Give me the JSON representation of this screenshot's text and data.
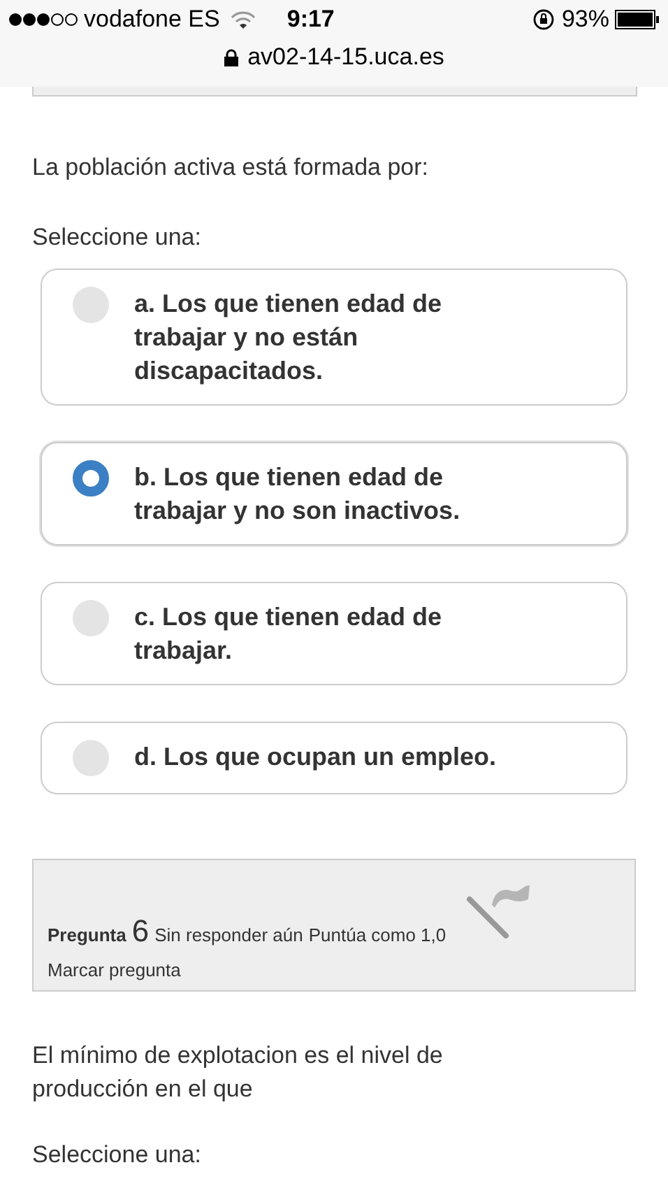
{
  "status_bar": {
    "carrier": "vodafone ES",
    "time": "9:17",
    "battery": "93%"
  },
  "address_bar": {
    "url": "av02-14-15.uca.es"
  },
  "question_5": {
    "text": "La población activa está formada por:",
    "prompt": "Seleccione una:",
    "options": [
      {
        "label": "a. Los que tienen edad de trabajar y no están discapacitados.",
        "selected": false
      },
      {
        "label": "b. Los que tienen edad de trabajar y no son inactivos.",
        "selected": true
      },
      {
        "label": "c. Los que tienen edad de trabajar.",
        "selected": false
      },
      {
        "label": "d. Los que ocupan un empleo.",
        "selected": false
      }
    ]
  },
  "question_6": {
    "info": {
      "label": "Pregunta",
      "number": "6",
      "status": "Sin responder aún",
      "grade": "Puntúa como 1,0",
      "flag_link": "Marcar pregunta"
    },
    "text": "El mínimo de explotacion es el nivel de producción en el que",
    "prompt": "Seleccione una:"
  }
}
